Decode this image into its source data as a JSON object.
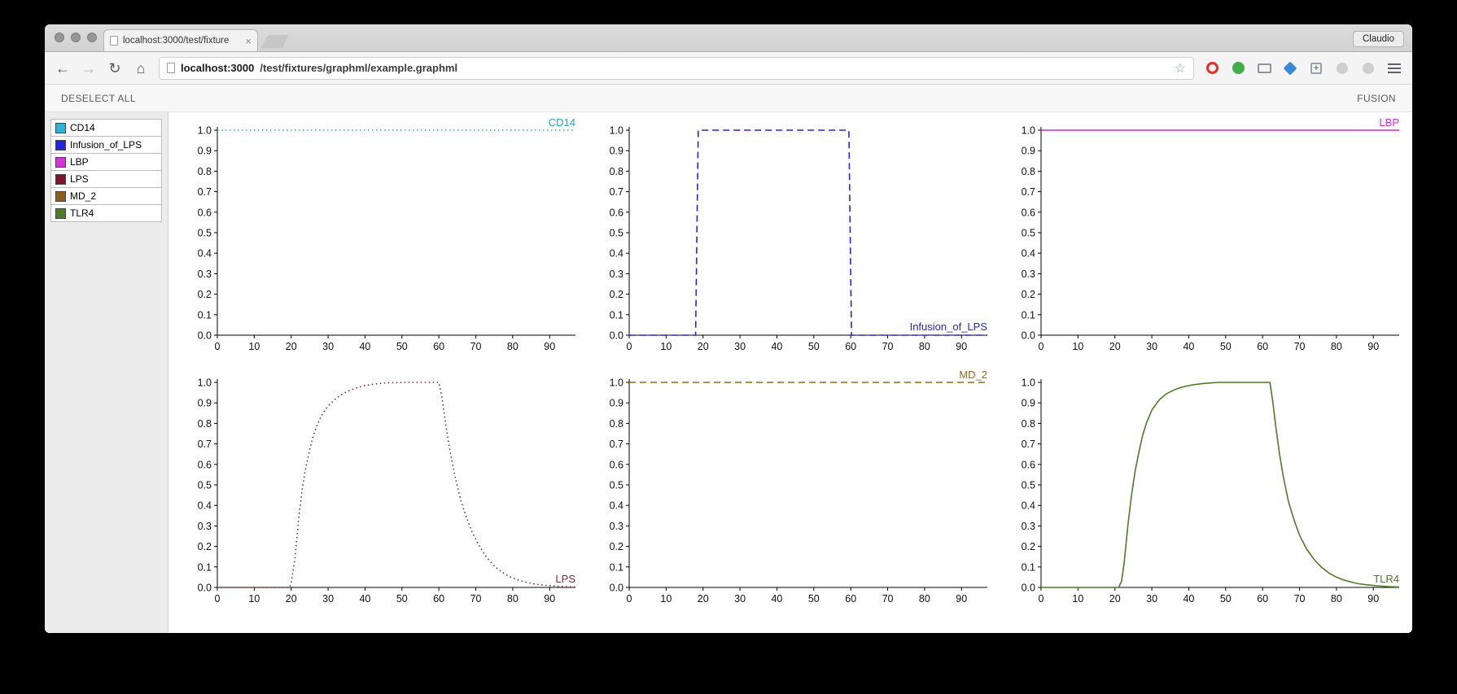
{
  "window": {
    "tab_title": "localhost:3000/test/fixture",
    "profile_label": "Claudio",
    "url_host": "localhost:3000",
    "url_path": "/test/fixtures/graphml/example.graphml"
  },
  "app": {
    "deselect_all_label": "DESELECT ALL",
    "fusion_label": "FUSION",
    "sidebar": {
      "items": [
        {
          "label": "CD14",
          "color": "#2fb3d6"
        },
        {
          "label": "Infusion_of_LPS",
          "color": "#2424dd"
        },
        {
          "label": "LBP",
          "color": "#d633d6"
        },
        {
          "label": "LPS",
          "color": "#7e1530"
        },
        {
          "label": "MD_2",
          "color": "#8a5c22"
        },
        {
          "label": "TLR4",
          "color": "#4f7a28"
        }
      ]
    }
  },
  "chart_data": [
    {
      "type": "line",
      "title": "CD14",
      "label_position": "top-right",
      "color": "#2aa5c4",
      "line_style": "dotted",
      "xlim": [
        0,
        97
      ],
      "ylim": [
        0,
        1
      ],
      "x_ticks": [
        0,
        10,
        20,
        30,
        40,
        50,
        60,
        70,
        80,
        90
      ],
      "y_ticks": [
        0,
        0.1,
        0.2,
        0.3,
        0.4,
        0.5,
        0.6,
        0.7,
        0.8,
        0.9,
        1.0
      ],
      "points": [
        [
          0,
          1
        ],
        [
          97,
          1
        ]
      ]
    },
    {
      "type": "line",
      "title": "Infusion_of_LPS",
      "label_position": "bottom-right",
      "color": "#2424dd",
      "line_style": "dashed",
      "xlim": [
        0,
        97
      ],
      "ylim": [
        0,
        1
      ],
      "x_ticks": [
        0,
        10,
        20,
        30,
        40,
        50,
        60,
        70,
        80,
        90
      ],
      "y_ticks": [
        0,
        0.1,
        0.2,
        0.3,
        0.4,
        0.5,
        0.6,
        0.7,
        0.8,
        0.9,
        1.0
      ],
      "points": [
        [
          0,
          0
        ],
        [
          18,
          0
        ],
        [
          18.7,
          1
        ],
        [
          59.5,
          1
        ],
        [
          60.2,
          0
        ],
        [
          97,
          0
        ]
      ]
    },
    {
      "type": "line",
      "title": "LBP",
      "label_position": "top-right",
      "color": "#cc2fcc",
      "line_style": "solid",
      "xlim": [
        0,
        97
      ],
      "ylim": [
        0,
        1
      ],
      "x_ticks": [
        0,
        10,
        20,
        30,
        40,
        50,
        60,
        70,
        80,
        90
      ],
      "y_ticks": [
        0,
        0.1,
        0.2,
        0.3,
        0.4,
        0.5,
        0.6,
        0.7,
        0.8,
        0.9,
        1.0
      ],
      "points": [
        [
          0,
          1
        ],
        [
          97,
          1
        ]
      ]
    },
    {
      "type": "line",
      "title": "LPS",
      "label_position": "bottom-right",
      "color": "#8e2038",
      "line_style": "dotted",
      "xlim": [
        0,
        97
      ],
      "ylim": [
        0,
        1
      ],
      "x_ticks": [
        0,
        10,
        20,
        30,
        40,
        50,
        60,
        70,
        80,
        90
      ],
      "y_ticks": [
        0,
        0.1,
        0.2,
        0.3,
        0.4,
        0.5,
        0.6,
        0.7,
        0.8,
        0.9,
        1.0
      ],
      "points": [
        [
          0,
          0
        ],
        [
          19.5,
          0
        ],
        [
          20,
          0.02
        ],
        [
          21,
          0.14
        ],
        [
          22,
          0.33
        ],
        [
          23,
          0.48
        ],
        [
          24,
          0.59
        ],
        [
          25,
          0.67
        ],
        [
          26,
          0.74
        ],
        [
          27,
          0.79
        ],
        [
          28,
          0.83
        ],
        [
          29,
          0.86
        ],
        [
          30,
          0.885
        ],
        [
          32,
          0.92
        ],
        [
          34,
          0.945
        ],
        [
          36,
          0.962
        ],
        [
          38,
          0.975
        ],
        [
          40,
          0.985
        ],
        [
          43,
          0.993
        ],
        [
          46,
          0.998
        ],
        [
          50,
          1
        ],
        [
          55,
          1
        ],
        [
          60,
          1
        ],
        [
          60.8,
          0.93
        ],
        [
          61.5,
          0.84
        ],
        [
          62.5,
          0.72
        ],
        [
          63.5,
          0.62
        ],
        [
          64.5,
          0.53
        ],
        [
          66,
          0.42
        ],
        [
          67.5,
          0.34
        ],
        [
          69,
          0.27
        ],
        [
          71,
          0.2
        ],
        [
          73,
          0.145
        ],
        [
          75,
          0.105
        ],
        [
          77,
          0.075
        ],
        [
          79,
          0.054
        ],
        [
          81,
          0.039
        ],
        [
          83,
          0.028
        ],
        [
          85,
          0.02
        ],
        [
          87,
          0.014
        ],
        [
          89,
          0.01
        ],
        [
          92,
          0.006
        ],
        [
          95,
          0.003
        ],
        [
          97,
          0.002
        ]
      ]
    },
    {
      "type": "line",
      "title": "MD_2",
      "label_position": "top-right",
      "color": "#8a6a1e",
      "line_style": "dashed",
      "xlim": [
        0,
        97
      ],
      "ylim": [
        0,
        1
      ],
      "x_ticks": [
        0,
        10,
        20,
        30,
        40,
        50,
        60,
        70,
        80,
        90
      ],
      "y_ticks": [
        0,
        0.1,
        0.2,
        0.3,
        0.4,
        0.5,
        0.6,
        0.7,
        0.8,
        0.9,
        1.0
      ],
      "points": [
        [
          0,
          1
        ],
        [
          97,
          1
        ]
      ]
    },
    {
      "type": "line",
      "title": "TLR4",
      "label_position": "bottom-right",
      "color": "#4f7a28",
      "line_style": "solid",
      "xlim": [
        0,
        97
      ],
      "ylim": [
        0,
        1
      ],
      "x_ticks": [
        0,
        10,
        20,
        30,
        40,
        50,
        60,
        70,
        80,
        90
      ],
      "y_ticks": [
        0,
        0.1,
        0.2,
        0.3,
        0.4,
        0.5,
        0.6,
        0.7,
        0.8,
        0.9,
        1.0
      ],
      "points": [
        [
          0,
          0
        ],
        [
          21,
          0
        ],
        [
          21.8,
          0.03
        ],
        [
          22.5,
          0.12
        ],
        [
          23.5,
          0.3
        ],
        [
          24.5,
          0.45
        ],
        [
          25.5,
          0.57
        ],
        [
          26.5,
          0.66
        ],
        [
          27.5,
          0.74
        ],
        [
          28.5,
          0.8
        ],
        [
          30,
          0.865
        ],
        [
          32,
          0.915
        ],
        [
          34,
          0.945
        ],
        [
          36,
          0.963
        ],
        [
          38,
          0.976
        ],
        [
          41,
          0.988
        ],
        [
          44,
          0.995
        ],
        [
          48,
          1
        ],
        [
          55,
          1
        ],
        [
          62,
          1
        ],
        [
          62.8,
          0.9
        ],
        [
          63.6,
          0.78
        ],
        [
          64.6,
          0.65
        ],
        [
          65.6,
          0.54
        ],
        [
          67,
          0.42
        ],
        [
          68.5,
          0.33
        ],
        [
          70,
          0.255
        ],
        [
          72,
          0.185
        ],
        [
          74,
          0.135
        ],
        [
          76,
          0.098
        ],
        [
          78,
          0.07
        ],
        [
          80,
          0.05
        ],
        [
          82,
          0.036
        ],
        [
          84,
          0.026
        ],
        [
          86,
          0.018
        ],
        [
          88,
          0.013
        ],
        [
          91,
          0.008
        ],
        [
          94,
          0.004
        ],
        [
          97,
          0.002
        ]
      ]
    }
  ]
}
